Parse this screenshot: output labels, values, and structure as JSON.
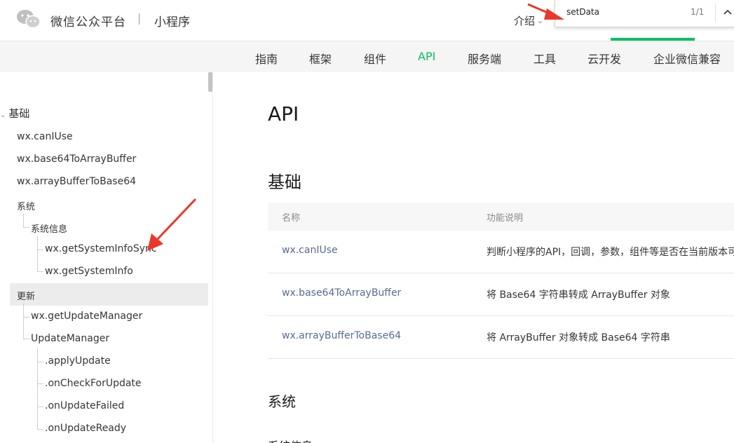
{
  "header": {
    "brand": "微信公众平台",
    "product": "小程序",
    "intro_label": "介绍",
    "intro_chevron": "⌄"
  },
  "findbar": {
    "query": "setData",
    "count": "1/1",
    "up_icon": "chevron-up-icon"
  },
  "nav": {
    "items": [
      {
        "label": "指南"
      },
      {
        "label": "框架"
      },
      {
        "label": "组件"
      },
      {
        "label": "API"
      },
      {
        "label": "服务端"
      },
      {
        "label": "工具"
      },
      {
        "label": "云开发"
      },
      {
        "label": "企业微信兼容"
      }
    ],
    "active": "API"
  },
  "sidebar": {
    "section": "基础",
    "items": [
      {
        "label": "wx.canIUse"
      },
      {
        "label": "wx.base64ToArrayBuffer"
      },
      {
        "label": "wx.arrayBufferToBase64"
      },
      {
        "label": "系统"
      },
      {
        "label": "系统信息"
      },
      {
        "label": "wx.getSystemInfoSync"
      },
      {
        "label": "wx.getSystemInfo"
      },
      {
        "label": "更新"
      },
      {
        "label": "wx.getUpdateManager"
      },
      {
        "label": "UpdateManager"
      },
      {
        "label": ".applyUpdate"
      },
      {
        "label": ".onCheckForUpdate"
      },
      {
        "label": ".onUpdateFailed"
      },
      {
        "label": ".onUpdateReady"
      }
    ]
  },
  "content": {
    "title": "API",
    "section": "基础",
    "table": {
      "headers": [
        "名称",
        "功能说明"
      ],
      "rows": [
        {
          "name": "wx.canIUse",
          "desc": "判断小程序的API，回调，参数，组件等是否在当前版本可用"
        },
        {
          "name": "wx.base64ToArrayBuffer",
          "desc": "将 Base64 字符串转成 ArrayBuffer 对象"
        },
        {
          "name": "wx.arrayBufferToBase64",
          "desc": "将 ArrayBuffer 对象转成 Base64 字符串"
        }
      ]
    },
    "subsection": "系统",
    "subsection2": "系统信息"
  },
  "colors": {
    "accent": "#07c160",
    "link": "#576b95",
    "arrow": "#e8392c"
  }
}
